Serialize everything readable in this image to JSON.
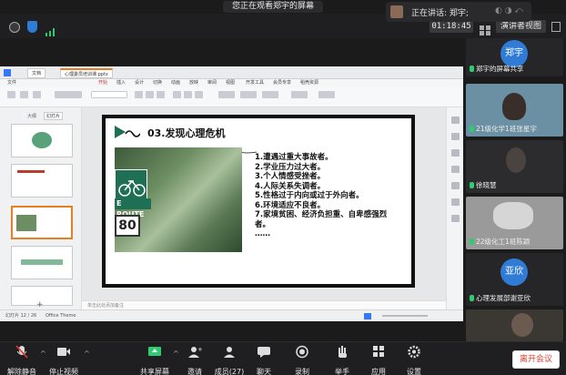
{
  "banner": {
    "text": "您正在观看郑宇的屏幕"
  },
  "speaking": {
    "label": "正在讲话: 郑宇;"
  },
  "topbar": {
    "timer": "01:18:45",
    "view_mode": "演讲者视图"
  },
  "wps": {
    "tabs": [
      "文档",
      "心理委员培训课.pptx"
    ],
    "menu": [
      "文件",
      "开始",
      "插入",
      "设计",
      "切换",
      "动画",
      "放映",
      "审阅",
      "视图",
      "开发工具",
      "会员专享",
      "稻壳资源"
    ],
    "left_tabs": [
      "大纲",
      "幻灯片"
    ],
    "status_left": "幻灯片 12 / 26",
    "status_theme": "Office Theme",
    "notes_placeholder": "单击此处添加备注"
  },
  "slide": {
    "title": "03.发现心理危机",
    "sign_route": "E ROUTE",
    "sign_speed": "80",
    "items": [
      "1.遭遇过重大事故者。",
      "2.学业压力过大者。",
      "3.个人情感受挫者。",
      "4.人际关系失调者。",
      "5.性格过于内向或过于外向者。",
      "6.环境适应不良者。",
      "7.家境贫困、经济负担重、自卑感强烈者。",
      "……"
    ]
  },
  "participants": [
    {
      "name": "郑宇的屏幕共享",
      "avatar_text": "郑宇",
      "type": "avatar",
      "avatar_color": "#2f7bd6"
    },
    {
      "name": "21级化学1班张星宇",
      "type": "video"
    },
    {
      "name": "徐晓慧",
      "type": "video"
    },
    {
      "name": "22级化工1班陈颖",
      "type": "video"
    },
    {
      "name": "心理发展部谢亚欣",
      "avatar_text": "亚欣",
      "type": "avatar",
      "avatar_color": "#2f7bd6"
    }
  ],
  "toolbar": {
    "unmute": "解除静音",
    "stop_video": "停止视频",
    "share_screen": "共享屏幕",
    "invite": "邀请",
    "members": "成员(27)",
    "chat": "聊天",
    "record": "录制",
    "raise_hand": "举手",
    "apps": "应用",
    "settings": "设置",
    "leave": "离开会议"
  },
  "colors": {
    "accent_blue": "#2f7bd6",
    "leave_red": "#e03c31",
    "mic_green": "#2ecc71"
  }
}
